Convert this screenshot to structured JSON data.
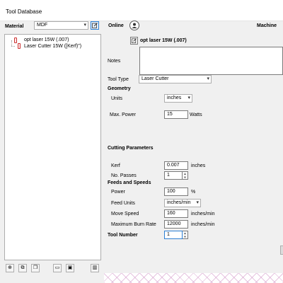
{
  "window": {
    "title": "Tool Database"
  },
  "left_panel": {
    "material_label": "Material",
    "material_value": "MDF",
    "tree": {
      "parent_label": "opt laser 15W (.007)",
      "child_label": "Laser Cutter 15W ([Kerf)\")"
    },
    "bottom_icons": [
      "add-icon",
      "duplicate-icon",
      "copy-icon",
      "folder-open-icon",
      "save-icon",
      "delete-icon"
    ]
  },
  "header": {
    "online_label": "Online",
    "machine_label": "Machine"
  },
  "tool": {
    "name": "opt laser 15W (.007)",
    "notes_label": "Notes",
    "notes_value": "",
    "tool_type_label": "Tool Type",
    "tool_type_value": "Laser Cutter"
  },
  "geometry": {
    "heading": "Geometry",
    "units_label": "Units",
    "units_value": "inches",
    "max_power_label": "Max. Power",
    "max_power_value": "15",
    "max_power_unit": "Watts"
  },
  "cutting": {
    "heading": "Cutting Parameters",
    "kerf_label": "Kerf",
    "kerf_value": "0.007",
    "kerf_unit": "inches",
    "passes_label": "No. Passes",
    "passes_value": "1"
  },
  "feeds": {
    "heading": "Feeds and Speeds",
    "power_label": "Power",
    "power_value": "100",
    "power_unit": "%",
    "feed_units_label": "Feed Units",
    "feed_units_value": "inches/min",
    "move_speed_label": "Move Speed",
    "move_speed_value": "160",
    "move_speed_unit": "inches/min",
    "burn_rate_label": "Maximum Burn Rate",
    "burn_rate_value": "12000",
    "burn_rate_unit": "inches/min"
  },
  "tool_number": {
    "label": "Tool Number",
    "value": "1"
  },
  "colors": {
    "accent": "#2d7fd3",
    "tree_icon": "#cc3333",
    "grid_lines": "#d296c8"
  }
}
